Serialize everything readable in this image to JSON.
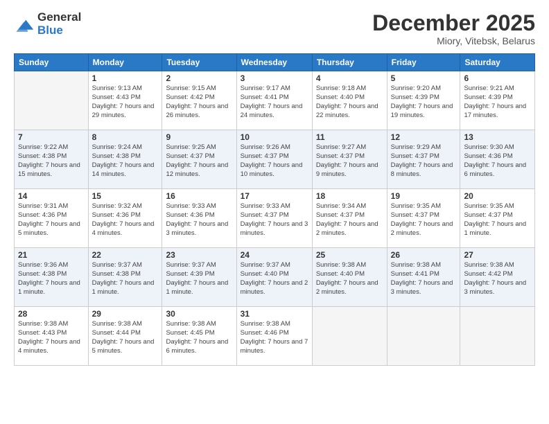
{
  "header": {
    "logo": {
      "general": "General",
      "blue": "Blue"
    },
    "title": "December 2025",
    "location": "Miory, Vitebsk, Belarus"
  },
  "days_of_week": [
    "Sunday",
    "Monday",
    "Tuesday",
    "Wednesday",
    "Thursday",
    "Friday",
    "Saturday"
  ],
  "weeks": [
    [
      {
        "day": "",
        "empty": true
      },
      {
        "day": "1",
        "sunrise": "Sunrise: 9:13 AM",
        "sunset": "Sunset: 4:43 PM",
        "daylight": "Daylight: 7 hours and 29 minutes."
      },
      {
        "day": "2",
        "sunrise": "Sunrise: 9:15 AM",
        "sunset": "Sunset: 4:42 PM",
        "daylight": "Daylight: 7 hours and 26 minutes."
      },
      {
        "day": "3",
        "sunrise": "Sunrise: 9:17 AM",
        "sunset": "Sunset: 4:41 PM",
        "daylight": "Daylight: 7 hours and 24 minutes."
      },
      {
        "day": "4",
        "sunrise": "Sunrise: 9:18 AM",
        "sunset": "Sunset: 4:40 PM",
        "daylight": "Daylight: 7 hours and 22 minutes."
      },
      {
        "day": "5",
        "sunrise": "Sunrise: 9:20 AM",
        "sunset": "Sunset: 4:39 PM",
        "daylight": "Daylight: 7 hours and 19 minutes."
      },
      {
        "day": "6",
        "sunrise": "Sunrise: 9:21 AM",
        "sunset": "Sunset: 4:39 PM",
        "daylight": "Daylight: 7 hours and 17 minutes."
      }
    ],
    [
      {
        "day": "7",
        "sunrise": "Sunrise: 9:22 AM",
        "sunset": "Sunset: 4:38 PM",
        "daylight": "Daylight: 7 hours and 15 minutes."
      },
      {
        "day": "8",
        "sunrise": "Sunrise: 9:24 AM",
        "sunset": "Sunset: 4:38 PM",
        "daylight": "Daylight: 7 hours and 14 minutes."
      },
      {
        "day": "9",
        "sunrise": "Sunrise: 9:25 AM",
        "sunset": "Sunset: 4:37 PM",
        "daylight": "Daylight: 7 hours and 12 minutes."
      },
      {
        "day": "10",
        "sunrise": "Sunrise: 9:26 AM",
        "sunset": "Sunset: 4:37 PM",
        "daylight": "Daylight: 7 hours and 10 minutes."
      },
      {
        "day": "11",
        "sunrise": "Sunrise: 9:27 AM",
        "sunset": "Sunset: 4:37 PM",
        "daylight": "Daylight: 7 hours and 9 minutes."
      },
      {
        "day": "12",
        "sunrise": "Sunrise: 9:29 AM",
        "sunset": "Sunset: 4:37 PM",
        "daylight": "Daylight: 7 hours and 8 minutes."
      },
      {
        "day": "13",
        "sunrise": "Sunrise: 9:30 AM",
        "sunset": "Sunset: 4:36 PM",
        "daylight": "Daylight: 7 hours and 6 minutes."
      }
    ],
    [
      {
        "day": "14",
        "sunrise": "Sunrise: 9:31 AM",
        "sunset": "Sunset: 4:36 PM",
        "daylight": "Daylight: 7 hours and 5 minutes."
      },
      {
        "day": "15",
        "sunrise": "Sunrise: 9:32 AM",
        "sunset": "Sunset: 4:36 PM",
        "daylight": "Daylight: 7 hours and 4 minutes."
      },
      {
        "day": "16",
        "sunrise": "Sunrise: 9:33 AM",
        "sunset": "Sunset: 4:36 PM",
        "daylight": "Daylight: 7 hours and 3 minutes."
      },
      {
        "day": "17",
        "sunrise": "Sunrise: 9:33 AM",
        "sunset": "Sunset: 4:37 PM",
        "daylight": "Daylight: 7 hours and 3 minutes."
      },
      {
        "day": "18",
        "sunrise": "Sunrise: 9:34 AM",
        "sunset": "Sunset: 4:37 PM",
        "daylight": "Daylight: 7 hours and 2 minutes."
      },
      {
        "day": "19",
        "sunrise": "Sunrise: 9:35 AM",
        "sunset": "Sunset: 4:37 PM",
        "daylight": "Daylight: 7 hours and 2 minutes."
      },
      {
        "day": "20",
        "sunrise": "Sunrise: 9:35 AM",
        "sunset": "Sunset: 4:37 PM",
        "daylight": "Daylight: 7 hours and 1 minute."
      }
    ],
    [
      {
        "day": "21",
        "sunrise": "Sunrise: 9:36 AM",
        "sunset": "Sunset: 4:38 PM",
        "daylight": "Daylight: 7 hours and 1 minute."
      },
      {
        "day": "22",
        "sunrise": "Sunrise: 9:37 AM",
        "sunset": "Sunset: 4:38 PM",
        "daylight": "Daylight: 7 hours and 1 minute."
      },
      {
        "day": "23",
        "sunrise": "Sunrise: 9:37 AM",
        "sunset": "Sunset: 4:39 PM",
        "daylight": "Daylight: 7 hours and 1 minute."
      },
      {
        "day": "24",
        "sunrise": "Sunrise: 9:37 AM",
        "sunset": "Sunset: 4:40 PM",
        "daylight": "Daylight: 7 hours and 2 minutes."
      },
      {
        "day": "25",
        "sunrise": "Sunrise: 9:38 AM",
        "sunset": "Sunset: 4:40 PM",
        "daylight": "Daylight: 7 hours and 2 minutes."
      },
      {
        "day": "26",
        "sunrise": "Sunrise: 9:38 AM",
        "sunset": "Sunset: 4:41 PM",
        "daylight": "Daylight: 7 hours and 3 minutes."
      },
      {
        "day": "27",
        "sunrise": "Sunrise: 9:38 AM",
        "sunset": "Sunset: 4:42 PM",
        "daylight": "Daylight: 7 hours and 3 minutes."
      }
    ],
    [
      {
        "day": "28",
        "sunrise": "Sunrise: 9:38 AM",
        "sunset": "Sunset: 4:43 PM",
        "daylight": "Daylight: 7 hours and 4 minutes."
      },
      {
        "day": "29",
        "sunrise": "Sunrise: 9:38 AM",
        "sunset": "Sunset: 4:44 PM",
        "daylight": "Daylight: 7 hours and 5 minutes."
      },
      {
        "day": "30",
        "sunrise": "Sunrise: 9:38 AM",
        "sunset": "Sunset: 4:45 PM",
        "daylight": "Daylight: 7 hours and 6 minutes."
      },
      {
        "day": "31",
        "sunrise": "Sunrise: 9:38 AM",
        "sunset": "Sunset: 4:46 PM",
        "daylight": "Daylight: 7 hours and 7 minutes."
      },
      {
        "day": "",
        "empty": true
      },
      {
        "day": "",
        "empty": true
      },
      {
        "day": "",
        "empty": true
      }
    ]
  ]
}
